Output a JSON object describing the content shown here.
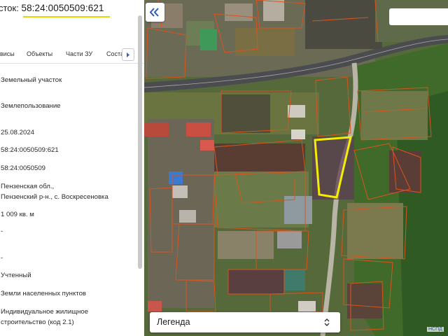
{
  "title": {
    "prefix": "сток:",
    "cadastral_number": "58:24:0050509:621",
    "underline_color": "#e8d400"
  },
  "tabs": [
    {
      "label": "висы"
    },
    {
      "label": "Объекты"
    },
    {
      "label": "Части ЗУ"
    },
    {
      "label": "Соста"
    }
  ],
  "tab_scroll_icon": "chevron-right-icon",
  "fields": [
    {
      "lines": [
        "Земельный участок"
      ]
    },
    {
      "lines": [
        "Землепользование"
      ]
    },
    {
      "lines": [
        "25.08.2024"
      ]
    },
    {
      "lines": [
        "58:24:0050509:621"
      ]
    },
    {
      "lines": [
        "58:24:0050509"
      ]
    },
    {
      "lines": [
        "Пензенская обл.,",
        "Пензенский р-н., с. Воскресеновка"
      ]
    },
    {
      "lines": [
        "1 009 кв. м"
      ]
    },
    {
      "lines": [
        "-"
      ]
    },
    {
      "lines": [
        "-"
      ]
    },
    {
      "lines": [
        "Учтенный"
      ]
    },
    {
      "lines": [
        "Земли населенных пунктов"
      ]
    },
    {
      "lines": [
        "Индивидуальное жилищное",
        "строительство (код 2.1)"
      ]
    }
  ],
  "map": {
    "collapse_icon": "double-chevron-left-icon",
    "highlight_color": "#f5ee00",
    "parcel_line_color": "#d9541e",
    "legend": {
      "label": "Легенда",
      "icon": "up-down-chevron-icon"
    },
    "watermark": "НСПД"
  }
}
